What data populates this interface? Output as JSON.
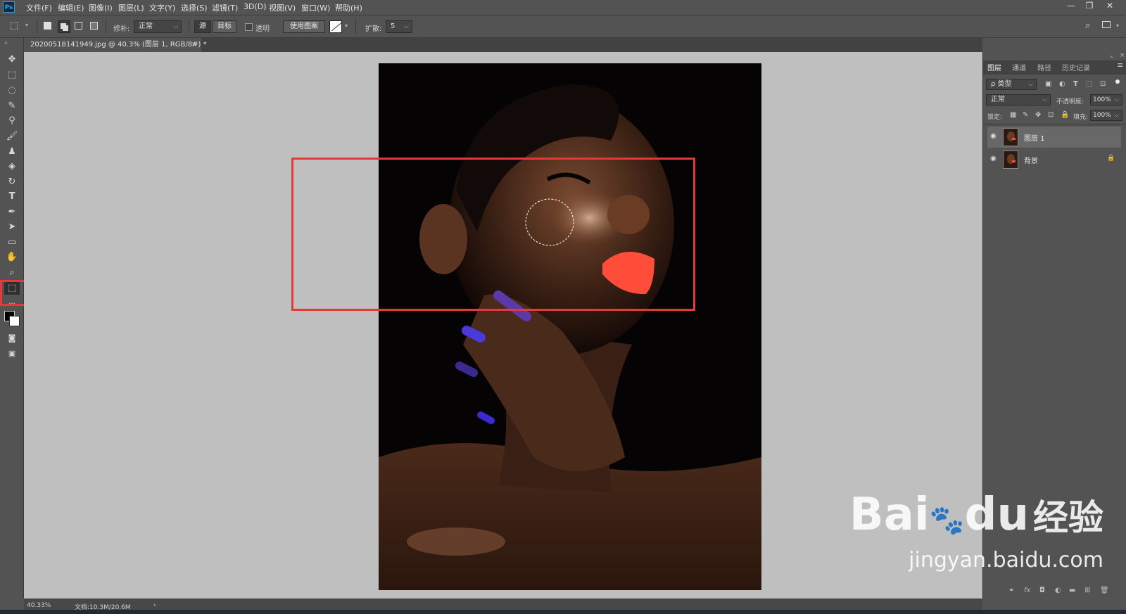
{
  "app": {
    "logo": "Ps",
    "menu": [
      "文件(F)",
      "编辑(E)",
      "图像(I)",
      "图层(L)",
      "文字(Y)",
      "选择(S)",
      "滤镜(T)",
      "3D(D)",
      "视图(V)",
      "窗口(W)",
      "帮助(H)"
    ],
    "window_controls": [
      "—",
      "❐",
      "✕"
    ]
  },
  "options": {
    "patch_label": "修补:",
    "patch_mode": "正常",
    "source_btn": "源",
    "target_btn": "目标",
    "transparent_label": "透明",
    "use_pattern_btn": "使用图案",
    "diffusion_label": "扩散:",
    "diffusion_value": "5"
  },
  "document": {
    "tab_title": "20200518141949.jpg @ 40.3% (图层 1, RGB/8#) *",
    "close": "×"
  },
  "panels": {
    "tabs": [
      "图层",
      "通道",
      "路径",
      "历史记录"
    ],
    "filter_kind": "ρ 类型",
    "blend_mode": "正常",
    "opacity_label": "不透明度:",
    "opacity_value": "100%",
    "lock_label": "锁定:",
    "fill_label": "填充:",
    "fill_value": "100%",
    "layers": [
      {
        "name": "图层 1",
        "selected": true,
        "locked": false
      },
      {
        "name": "背景",
        "selected": false,
        "locked": true
      }
    ]
  },
  "status": {
    "zoom": "40.33%",
    "doc_info": "文档:10.3M/20.6M",
    "arrow": "›"
  },
  "watermark": {
    "brand_a": "Bai",
    "brand_b": "du",
    "brand_c": "经验",
    "url": "jingyan.baidu.com"
  },
  "colors": {
    "highlight": "#e23a3a",
    "canvas_bg": "#bfbfbf",
    "ui_bg": "#535353"
  }
}
